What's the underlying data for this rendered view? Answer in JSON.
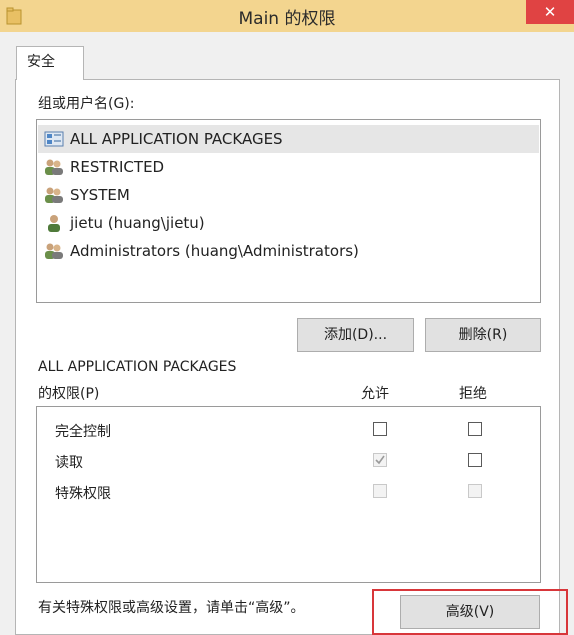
{
  "window": {
    "title": "Main 的权限",
    "close_symbol": "✕"
  },
  "tab": {
    "label": "安全"
  },
  "groups_label": "组或用户名(G):",
  "users": [
    {
      "name": "ALL APPLICATION PACKAGES",
      "icon": "app-packages-icon",
      "selected": true
    },
    {
      "name": "RESTRICTED",
      "icon": "user-group-icon"
    },
    {
      "name": "SYSTEM",
      "icon": "user-group-icon"
    },
    {
      "name": "jietu (huang\\jietu)",
      "icon": "user-icon"
    },
    {
      "name": "Administrators (huang\\Administrators)",
      "icon": "user-group-icon"
    }
  ],
  "buttons": {
    "add": "添加(D)...",
    "remove": "删除(R)",
    "advanced": "高级(V)"
  },
  "permissions_for_line1": "ALL APPLICATION PACKAGES",
  "permissions_for_line2": "的权限(P)",
  "col_allow": "允许",
  "col_deny": "拒绝",
  "permissions": [
    {
      "name": "完全控制",
      "allow": false,
      "deny": false,
      "disabled": false
    },
    {
      "name": "读取",
      "allow": true,
      "deny": false,
      "disabled": false
    },
    {
      "name": "特殊权限",
      "allow": false,
      "deny": false,
      "disabled": true
    }
  ],
  "footer_text": "有关特殊权限或高级设置，请单击“高级”。",
  "colors": {
    "titlebar": "#f3d58f",
    "close": "#e04343",
    "highlight_box": "#d8363a"
  }
}
